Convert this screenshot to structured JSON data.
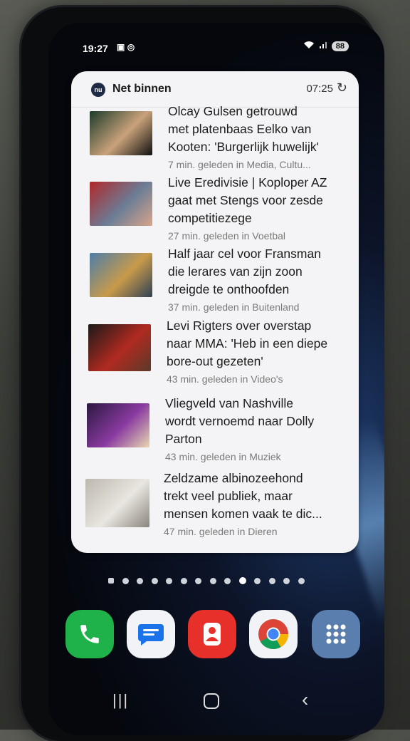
{
  "status_bar": {
    "time": "19:27",
    "left_icons": [
      "image-icon",
      "whatsapp-icon"
    ],
    "battery": "88"
  },
  "widget": {
    "logo_text": "nu",
    "title": "Net binnen",
    "time": "07:25",
    "items": [
      {
        "headline": "Olcay Gulsen getrouwd\nmet platenbaas Eelko van\nKooten: 'Burgerlijk huwelijk'",
        "meta": "7 min. geleden in Media, Cultu...",
        "thumb_colors": [
          "#1c3a2a",
          "#c9a27a",
          "#101010"
        ]
      },
      {
        "headline": "Live Eredivisie | Koploper AZ\ngaat met Stengs voor zesde\ncompetitiezege",
        "meta": "27 min. geleden in Voetbal",
        "thumb_colors": [
          "#b0282a",
          "#6b7d96",
          "#d8a48a"
        ]
      },
      {
        "headline": "Half jaar cel voor Fransman\ndie lerares van zijn zoon\ndreigde te onthoofden",
        "meta": "37 min. geleden in Buitenland",
        "thumb_colors": [
          "#4d7ea8",
          "#c89a4a",
          "#2e4054"
        ]
      },
      {
        "headline": "Levi Rigters over overstap\nnaar MMA: 'Heb in een diepe\nbore-out gezeten'",
        "meta": "43 min. geleden in Video's",
        "thumb_colors": [
          "#1a1a1a",
          "#b02a20",
          "#5a3a2a"
        ]
      },
      {
        "headline": "Vliegveld van Nashville\nwordt vernoemd naar Dolly\nParton",
        "meta": "43 min. geleden in Muziek",
        "thumb_colors": [
          "#2a1840",
          "#8a3aa0",
          "#e8d8b0"
        ]
      },
      {
        "headline": "Zeldzame albinozeehond\ntrekt veel publiek, maar\nmensen komen vaak te dic...",
        "meta": "47 min. geleden in Dieren",
        "thumb_colors": [
          "#bdb8ae",
          "#e8e6e0",
          "#8a857c"
        ]
      }
    ]
  },
  "page_dots": {
    "count": 14,
    "active_index": 9
  },
  "dock": [
    {
      "name": "phone-app",
      "icon": "phone-icon",
      "color": "#1fb14a"
    },
    {
      "name": "messages-app",
      "icon": "message-icon",
      "color": "#f1f3f6"
    },
    {
      "name": "contacts-app",
      "icon": "contact-icon",
      "color": "#e8302a"
    },
    {
      "name": "chrome-app",
      "icon": "chrome-icon",
      "color": "#f1f3f6"
    },
    {
      "name": "apps-drawer",
      "icon": "grid-icon",
      "color": "#5a7fae"
    }
  ]
}
